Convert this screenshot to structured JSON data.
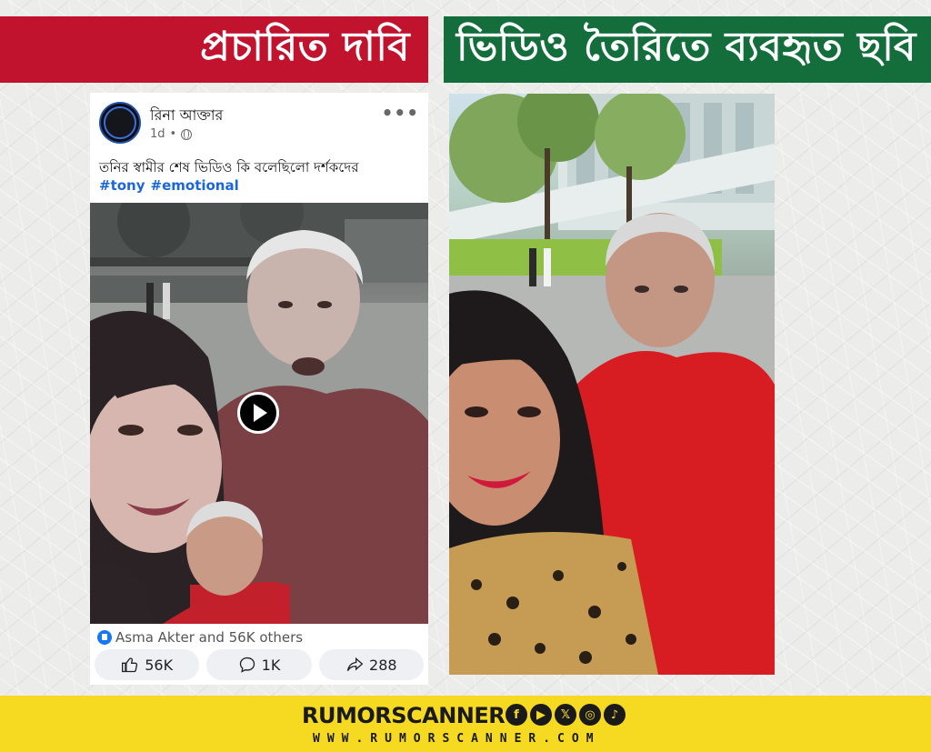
{
  "header": {
    "left_title": "প্রচারিত দাবি",
    "right_title": "ভিডিও তৈরিতে ব্যবহৃত ছবি"
  },
  "post": {
    "author": "রিনা আক্তার",
    "timestamp": "1d",
    "privacy_icon": "globe-icon",
    "more_icon": "more-options-icon",
    "more_symbol": "•••",
    "text": "তনির স্বামীর শেষ ভিডিও কি বলেছিলো দর্শকদের",
    "hashtags": [
      "#tony",
      "#emotional"
    ],
    "reactions_text": "Asma Akter and 56K others",
    "actions": {
      "like_count": "56K",
      "comment_count": "1K",
      "share_count": "288"
    }
  },
  "footer": {
    "brand": "RUMORSCANNER",
    "website": "WWW.RUMORSCANNER.COM",
    "social_icons": [
      "facebook-icon",
      "youtube-icon",
      "x-icon",
      "instagram-icon",
      "tiktok-icon"
    ],
    "social_glyphs": [
      "f",
      "▶",
      "𝕏",
      "◎",
      "♪"
    ]
  },
  "colors": {
    "left_banner": "#c1122e",
    "right_banner": "#136e3c",
    "footer": "#f6da22",
    "hashtag": "#1b66d9"
  }
}
